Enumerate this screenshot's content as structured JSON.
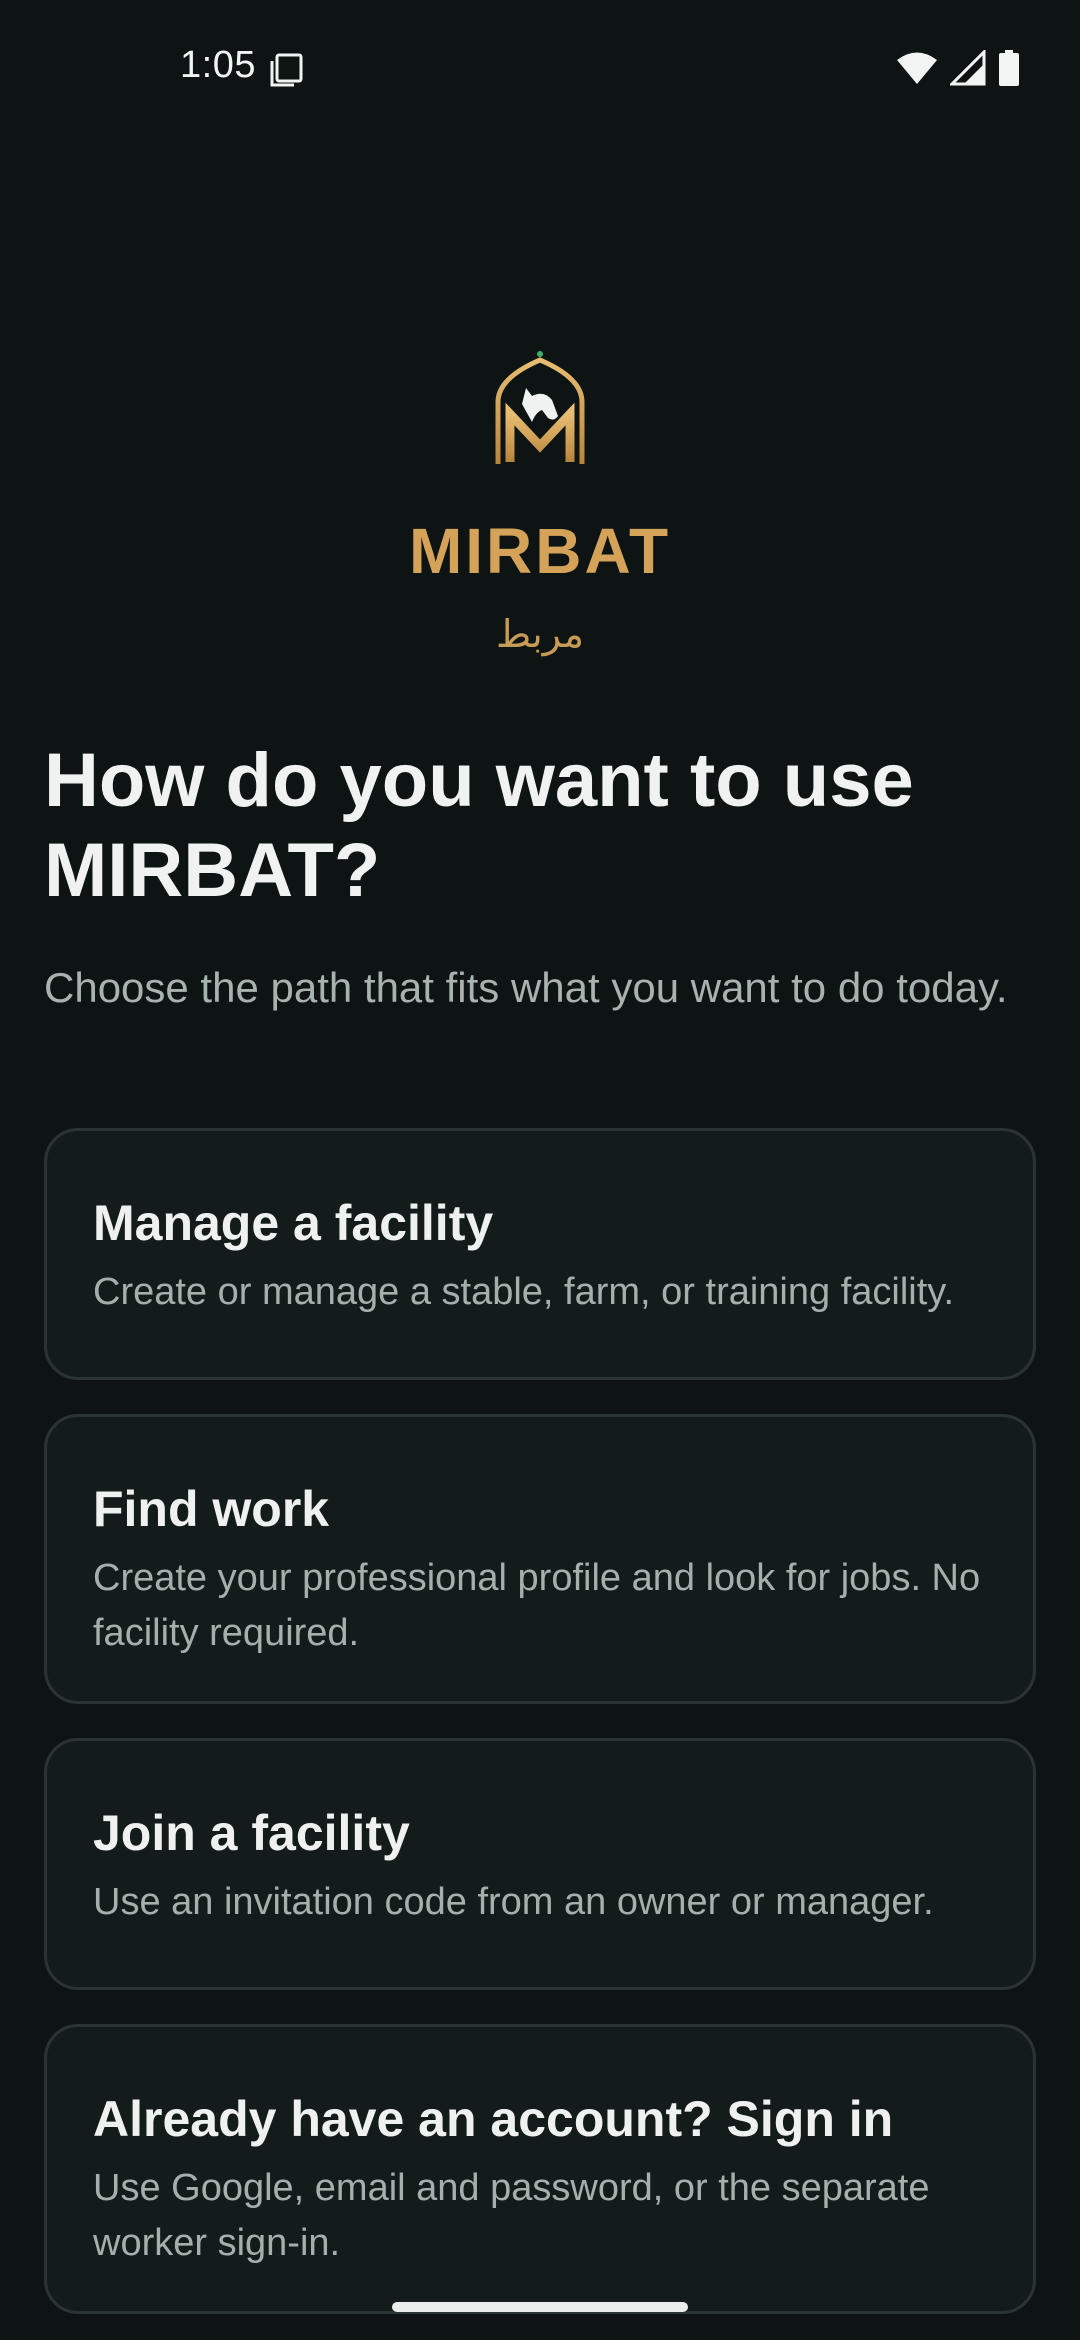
{
  "status_bar": {
    "time": "1:05",
    "icons": [
      "screenshot-icon",
      "wifi-icon",
      "signal-icon",
      "battery-icon"
    ]
  },
  "brand": {
    "name": "MIRBAT",
    "arabic_name": "مربط",
    "accent_color": "#d4a258"
  },
  "heading": {
    "title": "How do you want to use MIRBAT?",
    "subtitle": "Choose the path that fits what you want to do today."
  },
  "options": [
    {
      "title": "Manage a facility",
      "description": "Create or manage a stable, farm, or training facility."
    },
    {
      "title": "Find work",
      "description": "Create your professional profile and look for jobs. No facility required."
    },
    {
      "title": "Join a facility",
      "description": "Use an invitation code from an owner or manager."
    },
    {
      "title": "Already have an account? Sign in",
      "description": "Use Google, email and password, or the separate worker sign-in."
    }
  ]
}
